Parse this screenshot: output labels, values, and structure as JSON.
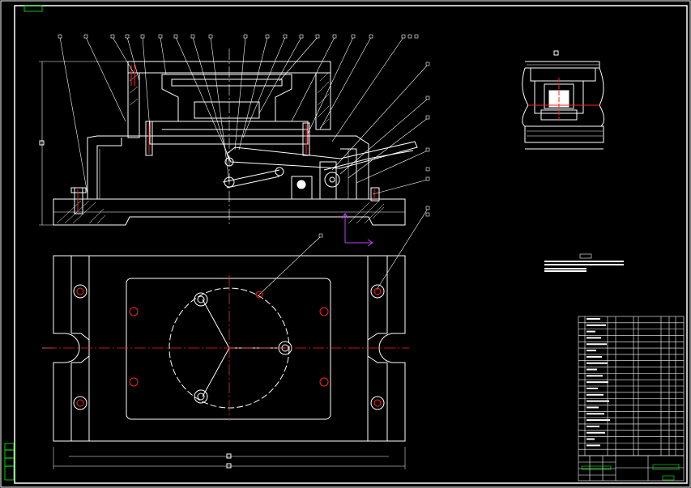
{
  "drawing": {
    "background": "#000000",
    "line_color": "#ffffff",
    "center_line_color": "#ff2020",
    "cursor_color": "#c040ff",
    "label_color": "#00ff00"
  },
  "views": {
    "front_section": {
      "callouts": 22
    },
    "plan_view": {
      "bolt_holes": 8
    },
    "detail_view": {},
    "parts_list": {
      "rows": 22
    },
    "title_block": {}
  }
}
